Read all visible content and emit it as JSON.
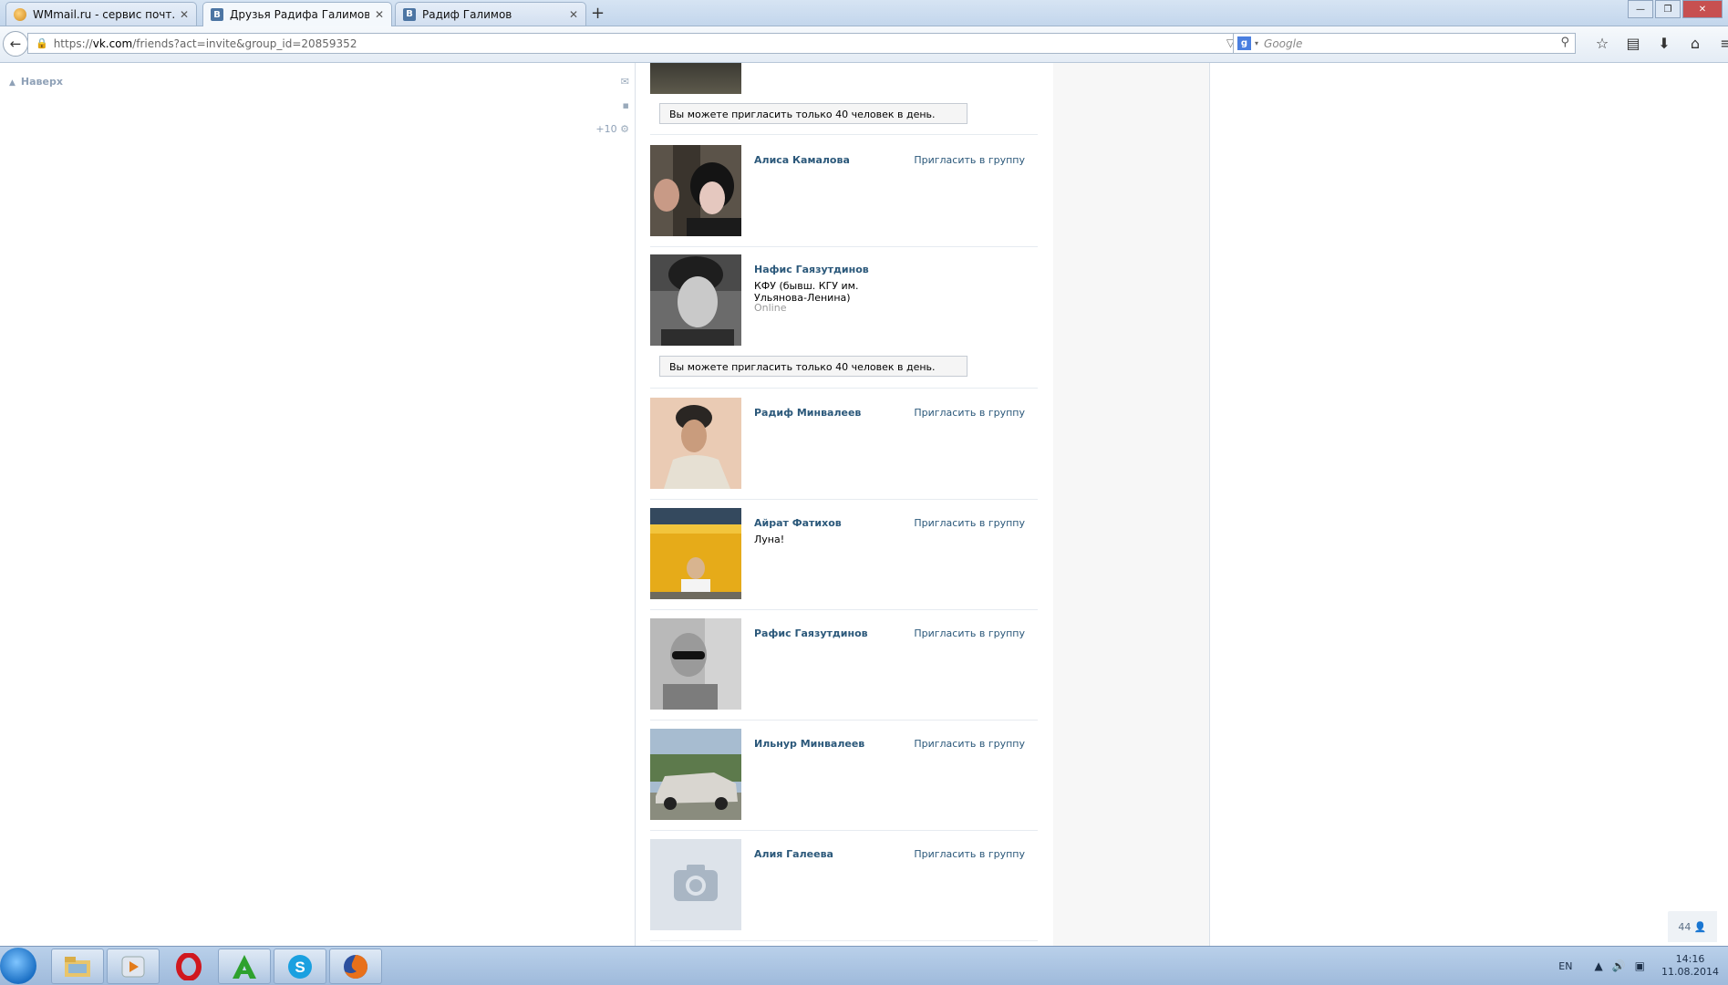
{
  "browser": {
    "tabs": [
      {
        "title": "WMmail.ru - сервис почт...",
        "favicon": "wmmail-favicon"
      },
      {
        "title": "Друзья Радифа Галимова ...",
        "favicon": "vk-favicon",
        "active": true
      },
      {
        "title": "Радиф Галимов",
        "favicon": "vk-favicon"
      }
    ],
    "url_prefix": "https://",
    "url_domain": "vk.com",
    "url_path": "/friends?act=invite&group_id=20859352",
    "search_placeholder": "Google",
    "vk_letter": "B",
    "google_letter": "g"
  },
  "sidebar": {
    "up_label": "Наверх",
    "notifications_count": "+10"
  },
  "friends": [
    {
      "name": "Алиса Камалова",
      "invite": "Пригласить в группу"
    },
    {
      "name": "Нафис Гаязутдинов",
      "sub": "КФУ (бывш. КГУ им. Ульянова-Ленина)",
      "status": "Online"
    },
    {
      "name": "Радиф Минвалеев",
      "invite": "Пригласить в группу"
    },
    {
      "name": "Айрат Фатихов",
      "sub": "Луна!",
      "invite": "Пригласить в группу"
    },
    {
      "name": "Рафис Гаязутдинов",
      "invite": "Пригласить в группу"
    },
    {
      "name": "Ильнур Минвалеев",
      "invite": "Пригласить в группу"
    },
    {
      "name": "Алия Галеева",
      "invite": "Пригласить в группу"
    }
  ],
  "limit_notice": "Вы можете пригласить только 40 человек в день.",
  "online_counter": "44",
  "taskbar": {
    "lang": "EN",
    "time": "14:16",
    "date": "11.08.2014",
    "apps": [
      "explorer",
      "media-player",
      "opera",
      "a-app",
      "skype",
      "firefox"
    ]
  }
}
